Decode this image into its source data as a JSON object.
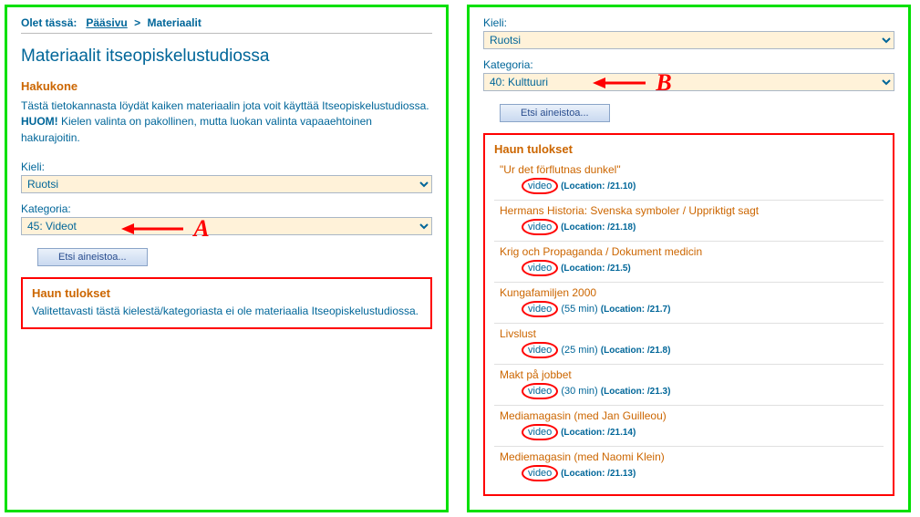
{
  "left": {
    "breadcrumb_label": "Olet tässä:",
    "breadcrumb_home": "Pääsivu",
    "breadcrumb_sep": ">",
    "breadcrumb_current": "Materiaalit",
    "title": "Materiaalit itseopiskelustudiossa",
    "subhead": "Hakukone",
    "desc_pre": "Tästä tietokannasta löydät kaiken materiaalin jota voit käyttää Itseopiskelustudiossa. ",
    "desc_bold": "HUOM!",
    "desc_post": " Kielen valinta on pakollinen, mutta luokan valinta vapaaehtoinen hakurajoitin.",
    "kieli_label": "Kieli:",
    "kieli_value": "Ruotsi",
    "kategoria_label": "Kategoria:",
    "kategoria_value": "45: Videot",
    "search_btn": "Etsi aineistoa...",
    "results_head": "Haun tulokset",
    "results_empty": "Valitettavasti tästä kielestä/kategoriasta ei ole materiaalia Itseopiskelustudiossa.",
    "annot_letter": "A"
  },
  "right": {
    "kieli_label": "Kieli:",
    "kieli_value": "Ruotsi",
    "kategoria_label": "Kategoria:",
    "kategoria_value": "40: Kulttuuri",
    "search_btn": "Etsi aineistoa...",
    "results_head": "Haun tulokset",
    "annot_letter": "B",
    "items": [
      {
        "title": "\"Ur det förflutnas dunkel\"",
        "tag": "video",
        "duration": "",
        "location": "(Location: /21.10)"
      },
      {
        "title": "Hermans Historia: Svenska symboler / Uppriktigt sagt",
        "tag": "video",
        "duration": "",
        "location": "(Location: /21.18)"
      },
      {
        "title": "Krig och Propaganda / Dokument medicin",
        "tag": "video",
        "duration": "",
        "location": "(Location: /21.5)"
      },
      {
        "title": "Kungafamiljen 2000",
        "tag": "video",
        "duration": "(55 min) ",
        "location": "(Location: /21.7)"
      },
      {
        "title": "Livslust",
        "tag": "video",
        "duration": "(25 min) ",
        "location": "(Location: /21.8)"
      },
      {
        "title": "Makt på jobbet",
        "tag": "video",
        "duration": "(30 min) ",
        "location": "(Location: /21.3)"
      },
      {
        "title": "Mediamagasin (med Jan Guilleou)",
        "tag": "video",
        "duration": "",
        "location": "(Location: /21.14)"
      },
      {
        "title": "Mediemagasin (med Naomi Klein)",
        "tag": "video",
        "duration": "",
        "location": "(Location: /21.13)"
      }
    ]
  }
}
